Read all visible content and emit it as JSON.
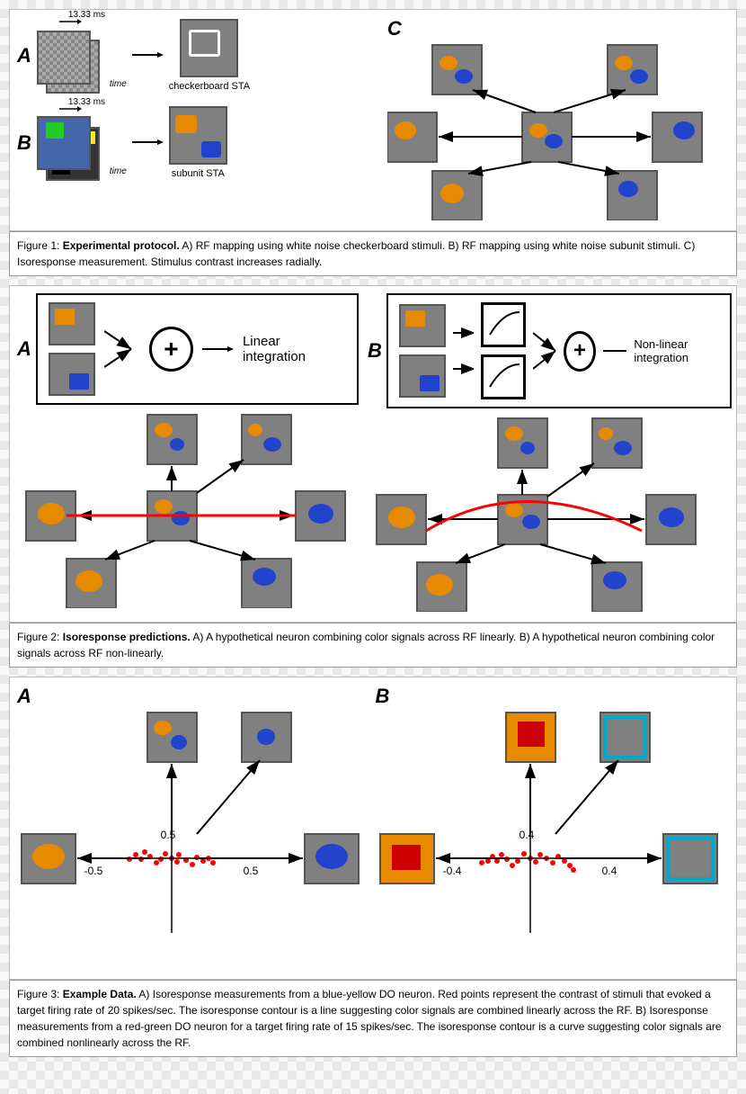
{
  "fig1": {
    "label_a": "A",
    "label_b": "B",
    "label_c": "C",
    "time_label": "time",
    "ms_label_a": "13.33 ms",
    "ms_label_b": "13.33 ms",
    "sta_label_a": "checkerboard STA",
    "sta_label_b": "subunit STA",
    "caption_title": "Figure 1:",
    "caption_bold": "Experimental protocol.",
    "caption_text": " A) RF mapping using white noise checkerboard stimuli. B) RF mapping using white noise subunit stimuli. C) Isoresponse measurement. Stimulus contrast increases radially."
  },
  "fig2": {
    "label_a": "A",
    "label_b": "B",
    "linear_label": "Linear integration",
    "nonlinear_label": "Non-linear integration",
    "caption_title": "Figure 2:",
    "caption_bold": "Isoresponse predictions.",
    "caption_text": " A) A hypothetical neuron combining color signals across RF linearly. B) A hypothetical neuron combining color signals across RF non-linearly."
  },
  "fig3": {
    "label_a": "A",
    "label_b": "B",
    "val_pos_half": "0.5",
    "val_neg_half": "-0.5",
    "val_pos_half_x": "0.5",
    "val_pos_04": "0.4",
    "val_neg_04": "-0.4",
    "val_pos_04_x": "0.4",
    "caption_title": "Figure 3:",
    "caption_bold": "Example Data.",
    "caption_text_a": " A) Isoresponse measurements from a blue-yellow DO neuron. Red points represent the contrast of stimuli that evoked a target firing rate of 20 spikes/sec.  The isoresponse contour is a line suggesting color signals are combined linearly across the RF.",
    "caption_text_b": " B) Isoresponse measurements from a red-green DO neuron for a target firing rate of 15 spikes/sec. The isoresponse contour is a curve suggesting color signals are combined nonlinearly across the RF."
  }
}
